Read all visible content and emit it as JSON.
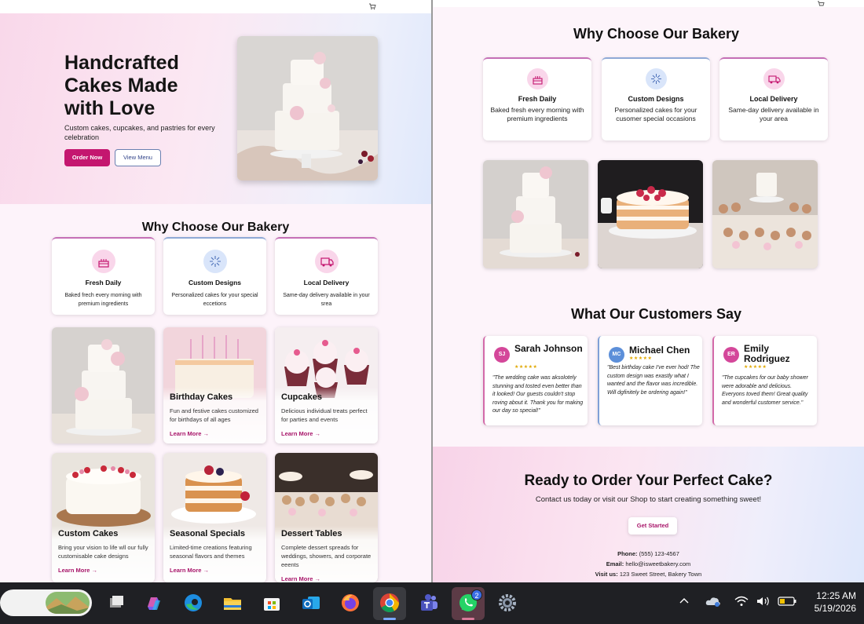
{
  "left": {
    "hero": {
      "title": "Handcrafted Cakes Made with Love",
      "subtitle": "Custom cakes, cupcakes, and pastries for every celebration",
      "order_btn": "Order Now",
      "menu_btn": "View Menu",
      "image_icon": "tiered-wedding-cake-photo"
    },
    "why_title": "Why Choose Our Bakery",
    "features": [
      {
        "title": "Fresh Daily",
        "desc": "Baked frech every morning with premium ingredients",
        "icon": "cake-icon"
      },
      {
        "title": "Custom Designs",
        "desc": "Personalized cakes for your special eccetions",
        "icon": "sparkle-icon"
      },
      {
        "title": "Local Delivery",
        "desc": "Same-day delivery available in your srea",
        "icon": "truck-icon"
      }
    ],
    "products": [
      {
        "title": "",
        "desc": "",
        "link": "",
        "image": "wedding-cake-photo"
      },
      {
        "title": "Birthday Cakes",
        "desc": "Fun and festive cakes customized for birthdays of all ages",
        "link": "Learn More →",
        "image": "birthday-cake-photo"
      },
      {
        "title": "Cupcakes",
        "desc": "Delicious individual treats perfect for parties and events",
        "link": "Learn More →",
        "image": "cupcakes-photo"
      },
      {
        "title": "Custom Cakes",
        "desc": "Bring your vision to life wll our fully customisable cake designs",
        "link": "Learn More →",
        "image": "custom-cake-photo"
      },
      {
        "title": "Seasonal Specials",
        "desc": "Limited-time creations featuring seasonal flavors and themes",
        "link": "Learn More →",
        "image": "seasonal-cake-photo"
      },
      {
        "title": "Dessert Tables",
        "desc": "Complete dessert spreads for weddings, showers, and corporate eeents",
        "link": "Learn More →",
        "image": "dessert-table-photo"
      }
    ]
  },
  "right": {
    "why_title": "Why Choose Our Bakery",
    "features": [
      {
        "title": "Fresh Daily",
        "desc": "Baked fresh every morning with premium ingredients",
        "icon": "cake-icon"
      },
      {
        "title": "Custom Designs",
        "desc": "Personalized cakes for your cusomer special occasions",
        "icon": "sparkle-icon"
      },
      {
        "title": "Local Delivery",
        "desc": "Same-day delivery available in your area",
        "icon": "truck-icon"
      }
    ],
    "gallery": [
      "wedding-cake-photo",
      "berry-layer-cake-photo",
      "dessert-display-photo"
    ],
    "testimonials_title": "What Our Customers Say",
    "testimonials": [
      {
        "initials": "SJ",
        "name": "Sarah Johnson",
        "stars": "★★★★★",
        "quote": "\"The wedding cake was aksolotely stunning and tosted even better than it looked! Our guests couldn't stop roving about it. Thank you for making our day so special!\"",
        "color": "#d4479a"
      },
      {
        "initials": "MC",
        "name": "Michael Chen",
        "stars": "★★★★★",
        "quote": "\"Best birthday cake I've ever hod! The custom design was exastly what I wanted and the flavor was incredible. Will dgfinitely be ordering again!\"",
        "color": "#5c8fd9"
      },
      {
        "initials": "ER",
        "name": "Emily Rodriguez",
        "stars": "★★★★★",
        "quote": "\"The cupcakes for our baby shower were adorable and delicious. Everyons toved them! Great quality and wonderful customer service.\"",
        "color": "#d4479a"
      }
    ],
    "cta": {
      "title": "Ready to Order Your Perfect Cake?",
      "subtitle": "Contact us today or visit our Shop to start creating something sweet!",
      "button": "Get Started",
      "phone_label": "Phone:",
      "phone": "(555) 123-4567",
      "email_label": "Email:",
      "email": "hello@isweetbakery.com",
      "visit_label": "Visit us:",
      "visit": "123 Sweet Street, Bakery Town"
    }
  },
  "taskbar": {
    "time": "12:25 AM",
    "date": "5/19/2026",
    "notification_count": "2",
    "apps": [
      "task-view-icon",
      "copilot-icon",
      "edge-icon",
      "file-explorer-icon",
      "microsoft-store-icon",
      "outlook-icon",
      "firefox-icon",
      "chrome-icon",
      "teams-icon",
      "whatsapp-icon",
      "settings-icon"
    ]
  },
  "colors": {
    "accent": "#c4166f",
    "pink_border": "#c56fb6",
    "blue_border": "#8fa9d6"
  }
}
